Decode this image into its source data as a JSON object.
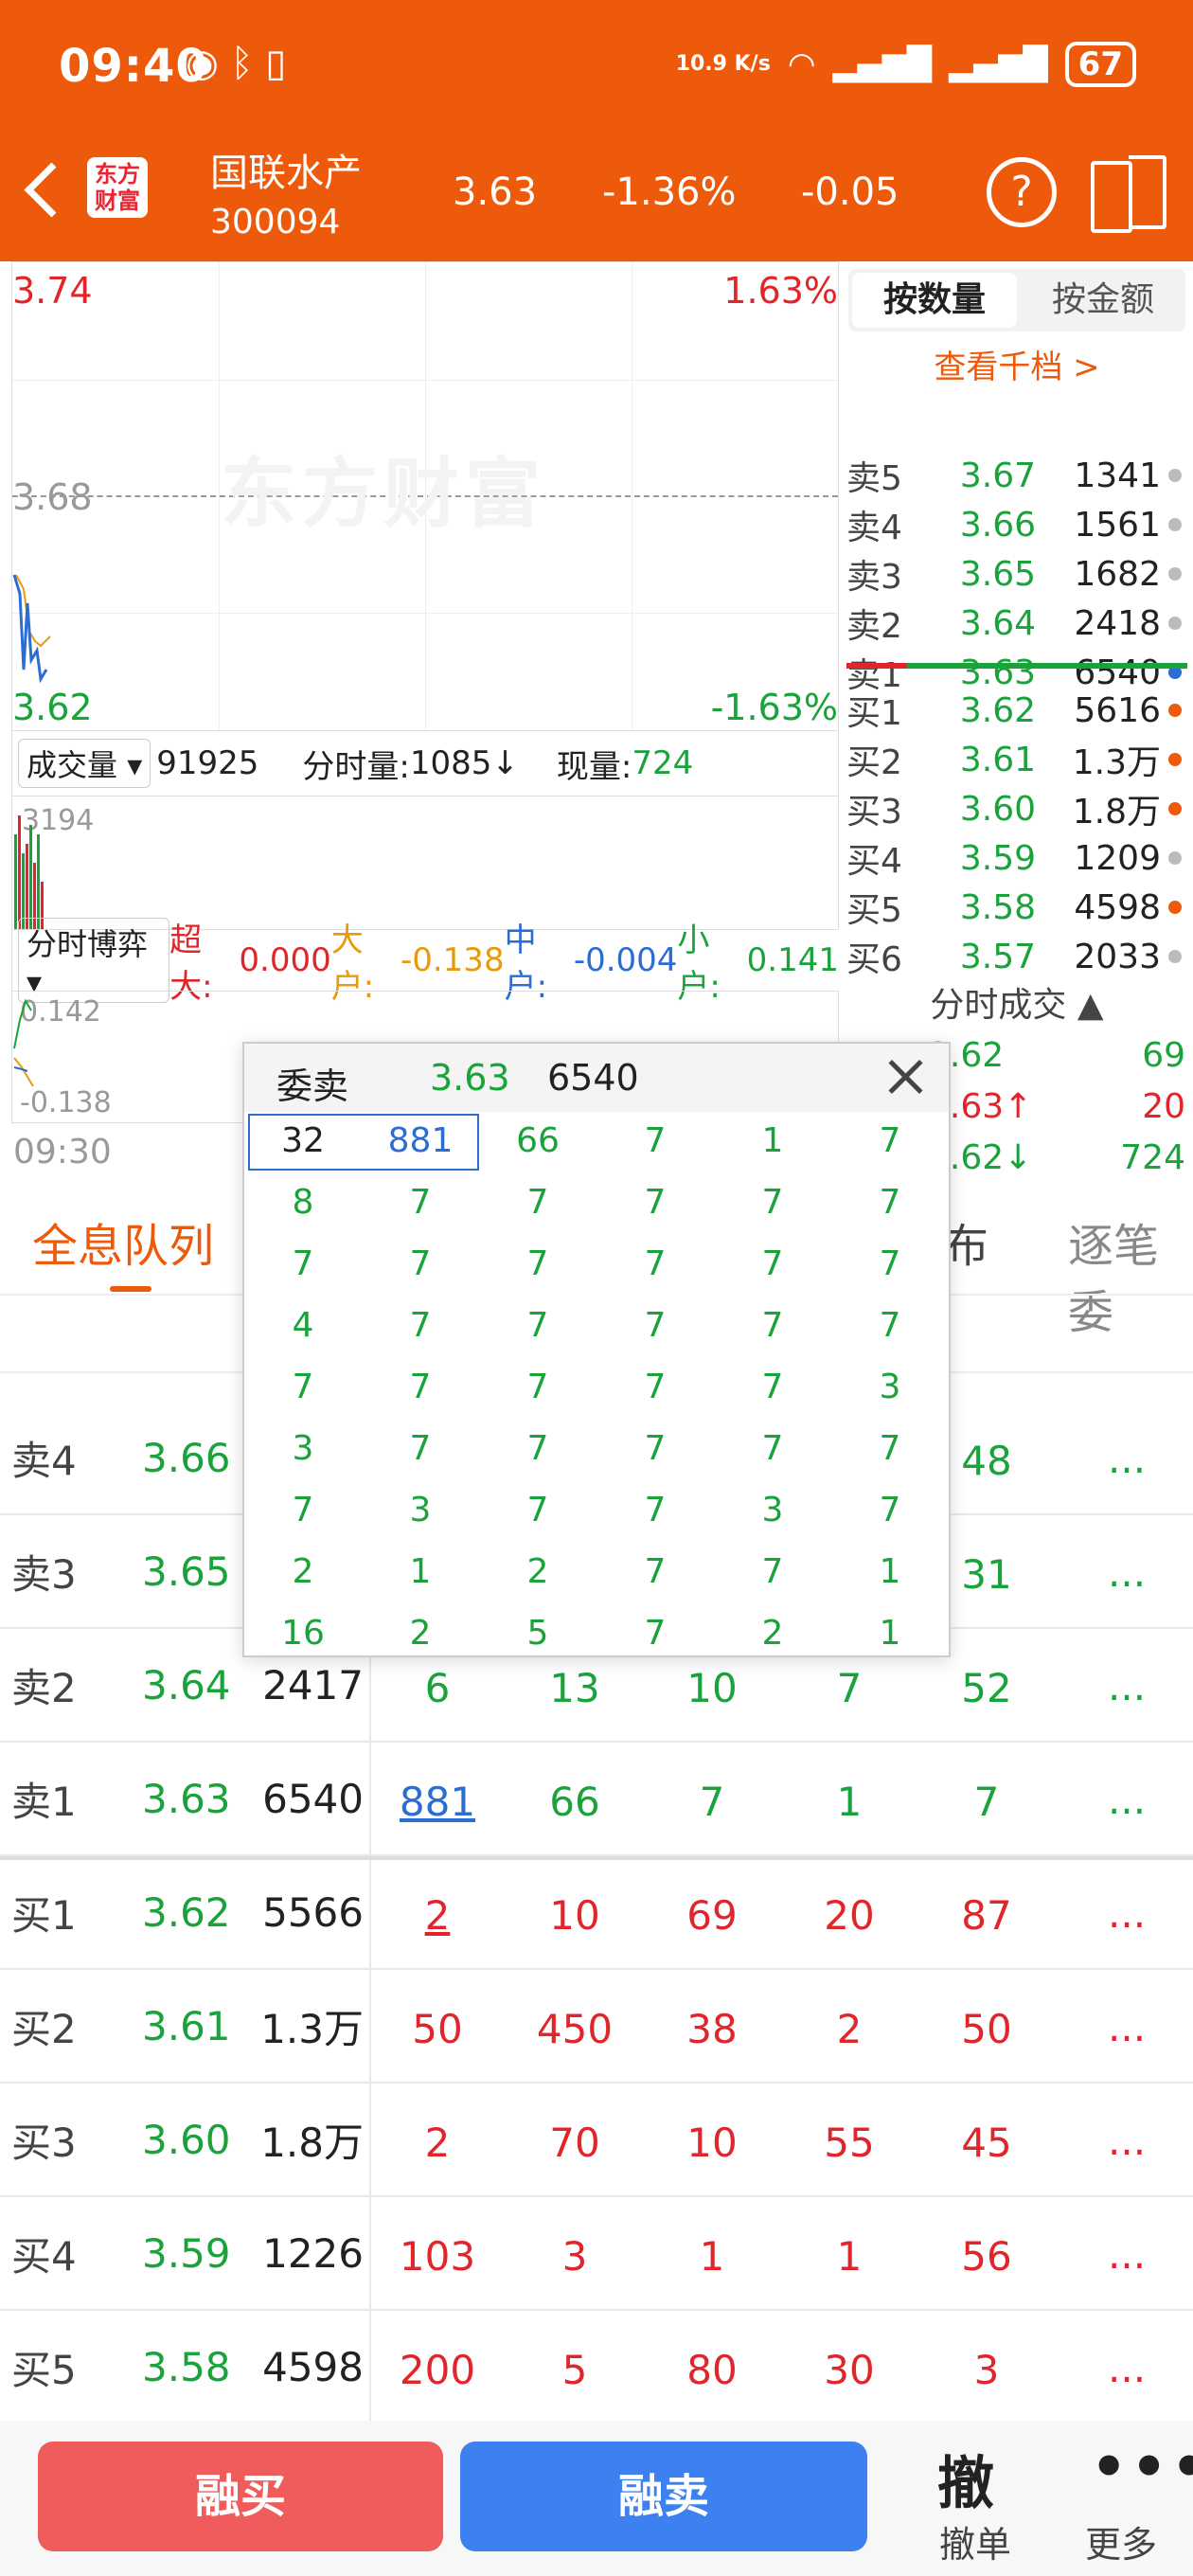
{
  "status_bar": {
    "time": "09:40",
    "speed": "10.9 K/s",
    "battery": "67"
  },
  "header": {
    "name": "国联水产",
    "code": "300094",
    "price": "3.63",
    "pct": "-1.36%",
    "change": "-0.05",
    "logo_top": "东方",
    "logo_bottom": "财富"
  },
  "chart": {
    "high": "3.74",
    "high_pct": "1.63%",
    "mid": "3.68",
    "low": "3.62",
    "low_pct": "-1.63%",
    "watermark": "东方财富",
    "time_start": "09:30"
  },
  "volume_bar": {
    "select": "成交量",
    "total": "91925",
    "fen_label": "分时量:",
    "fen_value": "1085",
    "now_label": "现量:",
    "now_value": "724",
    "vol_scale": "3194"
  },
  "bo_bar": {
    "select": "分时博弈",
    "chao_label": "超大:",
    "chao_value": "0.000",
    "da_label": "大户:",
    "da_value": "-0.138",
    "zhong_label": "中户:",
    "zhong_value": "-0.004",
    "xiao_label": "小户:",
    "xiao_value": "0.141",
    "top": "0.142",
    "bottom": "-0.138"
  },
  "right_panel": {
    "tab_qty": "按数量",
    "tab_amt": "按金额",
    "qian": "查看千档 >",
    "sells": [
      {
        "label": "卖5",
        "price": "3.67",
        "vol": "1341"
      },
      {
        "label": "卖4",
        "price": "3.66",
        "vol": "1561"
      },
      {
        "label": "卖3",
        "price": "3.65",
        "vol": "1682"
      },
      {
        "label": "卖2",
        "price": "3.64",
        "vol": "2418"
      },
      {
        "label": "卖1",
        "price": "3.63",
        "vol": "6540"
      }
    ],
    "buys": [
      {
        "label": "买1",
        "price": "3.62",
        "vol": "5616"
      },
      {
        "label": "买2",
        "price": "3.61",
        "vol": "1.3万"
      },
      {
        "label": "买3",
        "price": "3.60",
        "vol": "1.8万"
      },
      {
        "label": "买4",
        "price": "3.59",
        "vol": "1209"
      },
      {
        "label": "买5",
        "price": "3.58",
        "vol": "4598"
      },
      {
        "label": "买6",
        "price": "3.57",
        "vol": "2033"
      }
    ],
    "fs_title": "分时成交",
    "fs": [
      {
        "price": "3.62",
        "vol": "69"
      },
      {
        "price": "3.63↑",
        "vol": "20"
      },
      {
        "price": "3.62↓",
        "vol": "724"
      }
    ]
  },
  "tabs": {
    "active": "全息队列",
    "fenbu": "布",
    "zhubi": "逐笔委"
  },
  "queue": {
    "sells": [
      {
        "label": "卖4",
        "price": "3.66",
        "vol": "",
        "cells": [
          "",
          "",
          "",
          "",
          "48"
        ]
      },
      {
        "label": "卖3",
        "price": "3.65",
        "vol": "",
        "cells": [
          "",
          "",
          "",
          "",
          "31"
        ]
      },
      {
        "label": "卖2",
        "price": "3.64",
        "vol": "2417",
        "cells": [
          "6",
          "13",
          "10",
          "7",
          "52"
        ]
      },
      {
        "label": "卖1",
        "price": "3.63",
        "vol": "6540",
        "cells": [
          "881",
          "66",
          "7",
          "1",
          "7"
        ]
      }
    ],
    "buys": [
      {
        "label": "买1",
        "price": "3.62",
        "vol": "5566",
        "cells": [
          "2",
          "10",
          "69",
          "20",
          "87"
        ]
      },
      {
        "label": "买2",
        "price": "3.61",
        "vol": "1.3万",
        "cells": [
          "50",
          "450",
          "38",
          "2",
          "50"
        ]
      },
      {
        "label": "买3",
        "price": "3.60",
        "vol": "1.8万",
        "cells": [
          "2",
          "70",
          "10",
          "55",
          "45"
        ]
      },
      {
        "label": "买4",
        "price": "3.59",
        "vol": "1226",
        "cells": [
          "103",
          "3",
          "1",
          "1",
          "56"
        ]
      },
      {
        "label": "买5",
        "price": "3.58",
        "vol": "4598",
        "cells": [
          "200",
          "5",
          "80",
          "30",
          "3"
        ]
      }
    ],
    "more": "..."
  },
  "popup": {
    "title": "委卖",
    "price": "3.63",
    "vol": "6540",
    "grid": [
      [
        "32",
        "881",
        "66",
        "7",
        "1",
        "7"
      ],
      [
        "8",
        "7",
        "7",
        "7",
        "7",
        "7"
      ],
      [
        "7",
        "7",
        "7",
        "7",
        "7",
        "7"
      ],
      [
        "4",
        "7",
        "7",
        "7",
        "7",
        "7"
      ],
      [
        "7",
        "7",
        "7",
        "7",
        "7",
        "3"
      ],
      [
        "3",
        "7",
        "7",
        "7",
        "7",
        "7"
      ],
      [
        "7",
        "3",
        "7",
        "7",
        "3",
        "7"
      ],
      [
        "2",
        "1",
        "2",
        "7",
        "7",
        "1"
      ],
      [
        "16",
        "2",
        "5",
        "7",
        "2",
        "1"
      ]
    ]
  },
  "bottom": {
    "buy": "融买",
    "sell": "融卖",
    "cancel_glyph": "撤",
    "cancel": "撤单",
    "more_glyph": "•••",
    "more": "更多"
  },
  "colors": {
    "brand": "#EE5A0B",
    "up": "#E0252B",
    "down": "#1AA33A",
    "buy_btn": "#F05C5C",
    "sell_btn": "#3D80F0"
  }
}
